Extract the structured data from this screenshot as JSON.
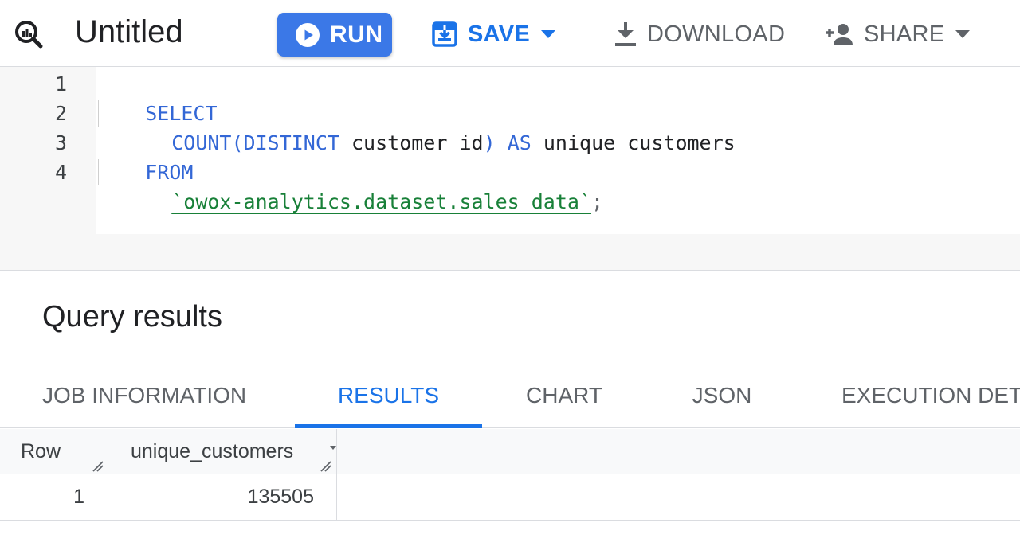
{
  "toolbar": {
    "title": "Untitled",
    "run_label": "RUN",
    "save_label": "SAVE",
    "download_label": "DOWNLOAD",
    "share_label": "SHARE",
    "accent_color": "#1a73e8",
    "run_button_color": "#3b78e7"
  },
  "editor": {
    "line_numbers": [
      "1",
      "2",
      "3",
      "4"
    ],
    "lines": [
      {
        "kw1": "SELECT"
      },
      {
        "kw1": "COUNT(DISTINCT",
        "ident": "customer_id",
        "close": ")",
        "kw2": "AS",
        "alias": "unique_customers"
      },
      {
        "kw1": "FROM"
      },
      {
        "table": "`owox-analytics.dataset.sales_data`",
        "end": ";"
      }
    ]
  },
  "results": {
    "title": "Query results",
    "tabs": [
      {
        "label": "JOB INFORMATION"
      },
      {
        "label": "RESULTS",
        "active": true
      },
      {
        "label": "CHART"
      },
      {
        "label": "JSON"
      },
      {
        "label": "EXECUTION DETA"
      }
    ],
    "table": {
      "columns": [
        "Row",
        "unique_customers"
      ],
      "rows": [
        [
          "1",
          "135505"
        ]
      ]
    }
  }
}
